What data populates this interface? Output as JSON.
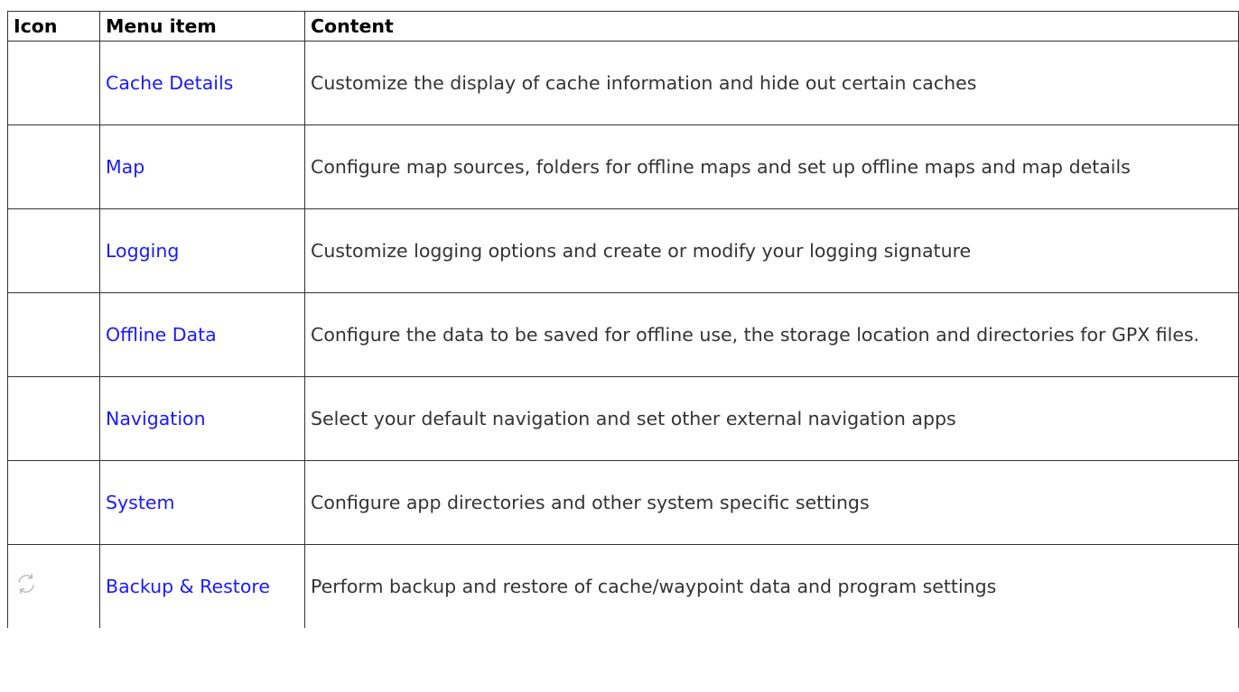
{
  "table": {
    "headers": {
      "icon": "Icon",
      "menu_item": "Menu item",
      "content": "Content"
    },
    "rows": [
      {
        "icon": "",
        "menu_item": "Cache Details",
        "content": "Customize the display of cache information and hide out certain caches"
      },
      {
        "icon": "",
        "menu_item": "Map",
        "content": "Configure map sources, folders for offline maps and set up offline maps and map details"
      },
      {
        "icon": "",
        "menu_item": "Logging",
        "content": "Customize logging options and create or modify your logging signature"
      },
      {
        "icon": "",
        "menu_item": "Offline Data",
        "content": "Configure the data to be saved for offline use, the storage location and directories for GPX files."
      },
      {
        "icon": "",
        "menu_item": "Navigation",
        "content": "Select your default navigation and set other external navigation apps"
      },
      {
        "icon": "",
        "menu_item": "System",
        "content": "Configure app directories and other system specific settings"
      },
      {
        "icon": "recycle-icon",
        "menu_item": "Backup & Restore",
        "content": "Perform backup and restore of cache/waypoint data and program settings"
      }
    ]
  },
  "colors": {
    "link": "#1a1aff",
    "border": "#333333",
    "text": "#333333"
  }
}
